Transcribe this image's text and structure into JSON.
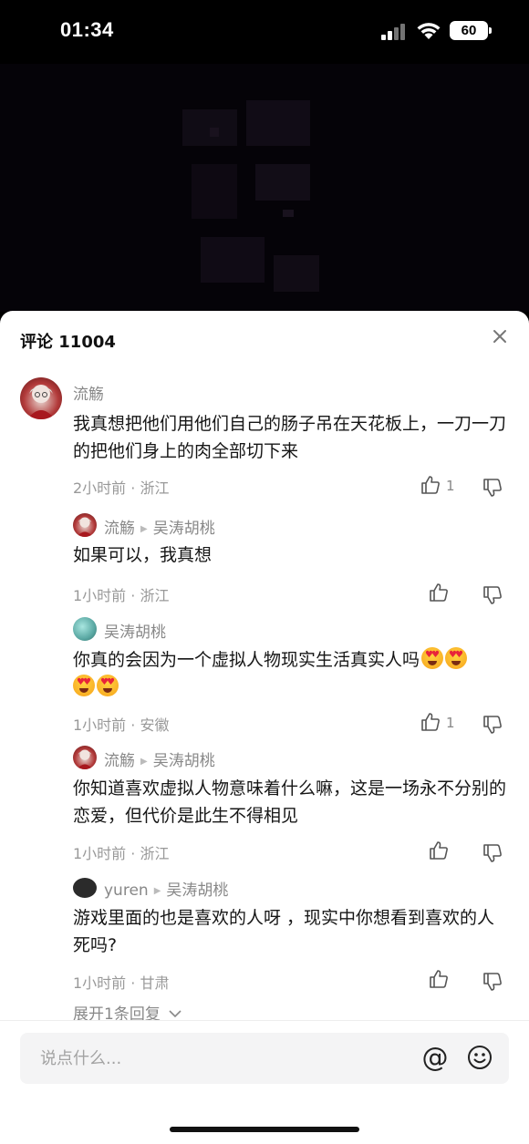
{
  "status_bar": {
    "time": "01:34",
    "battery": "60"
  },
  "comments_panel": {
    "title": "评论 11004",
    "comments": [
      {
        "user": "流觞",
        "text": "我真想把他们用他们自己的肠子吊在天花板上，一刀一刀的把他们身上的肉全部切下来",
        "meta": "2小时前 · 浙江",
        "likes": "1"
      },
      {
        "user": "流觞",
        "reply_to": "吴涛胡桃",
        "text": "如果可以，我真想",
        "meta": "1小时前 · 浙江",
        "likes": ""
      },
      {
        "user": "吴涛胡桃",
        "text": "你真的会因为一个虚拟人物现实生活真实人吗",
        "meta": "1小时前 · 安徽",
        "likes": "1"
      },
      {
        "user": "流觞",
        "reply_to": "吴涛胡桃",
        "text": "你知道喜欢虚拟人物意味着什么嘛，这是一场永不分别的恋爱，但代价是此生不得相见",
        "meta": "1小时前 · 浙江",
        "likes": ""
      },
      {
        "user": "yuren",
        "reply_to": "吴涛胡桃",
        "text": "游戏里面的也是喜欢的人呀 ，现实中你想看到喜欢的人死吗?",
        "meta": "1小时前 · 甘肃",
        "likes": ""
      }
    ],
    "expand_replies": "展开1条回复",
    "input_placeholder": "说点什么...",
    "at_symbol": "@"
  },
  "colors": {
    "sheet_bg": "#ffffff",
    "text_primary": "#161616",
    "text_secondary": "#888888",
    "input_bg": "#f4f4f5"
  }
}
